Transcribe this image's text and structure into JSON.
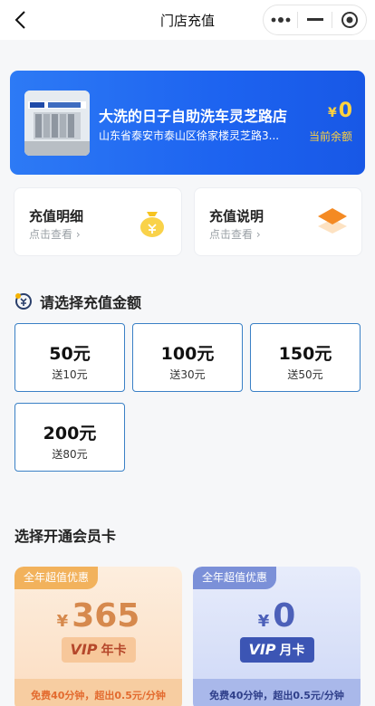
{
  "nav": {
    "title": "门店充值"
  },
  "store": {
    "name": "大洗的日子自助洗车灵芝路店",
    "address": "山东省泰安市泰山区徐家楼灵芝路3...",
    "balance_currency": "¥",
    "balance_value": "0",
    "balance_label": "当前余额"
  },
  "info_cards": [
    {
      "title": "充值明细",
      "subtitle": "点击查看"
    },
    {
      "title": "充值说明",
      "subtitle": "点击查看"
    }
  ],
  "recharge": {
    "title": "请选择充值金额",
    "options": [
      {
        "amount": "50元",
        "bonus": "送10元"
      },
      {
        "amount": "100元",
        "bonus": "送30元"
      },
      {
        "amount": "150元",
        "bonus": "送50元"
      },
      {
        "amount": "200元",
        "bonus": "送80元"
      }
    ]
  },
  "membership": {
    "title": "选择开通会员卡",
    "cards": [
      {
        "tag": "全年超值优惠",
        "currency": "¥",
        "price": "365",
        "vip": "VIP",
        "type": "年卡",
        "footer": "免费40分钟，超出0.5元/分钟"
      },
      {
        "tag": "全年超值优惠",
        "currency": "¥",
        "price": "0",
        "vip": "VIP",
        "type": "月卡",
        "footer": "免费40分钟，超出0.5元/分钟"
      }
    ]
  },
  "colors": {
    "banner_blue": "#1d63f0",
    "balance_gold": "#ffd23f",
    "option_border": "#3a80c6"
  }
}
